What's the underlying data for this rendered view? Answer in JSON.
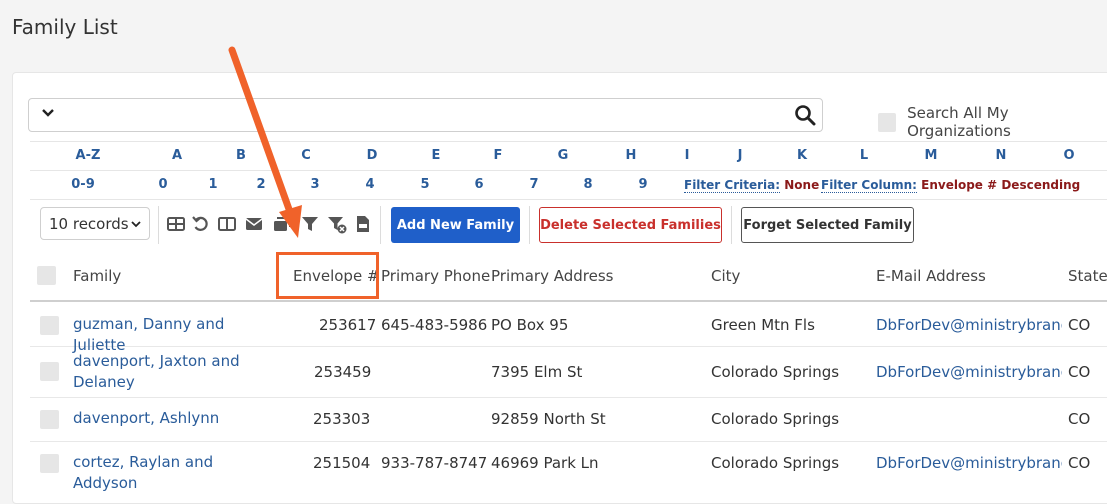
{
  "page": {
    "title": "Family List"
  },
  "search": {
    "option": "",
    "all_orgs_label": "Search All My Organizations"
  },
  "alpha": {
    "letters": [
      "A-Z",
      "A",
      "B",
      "C",
      "D",
      "E",
      "F",
      "G",
      "H",
      "I",
      "J",
      "K",
      "L",
      "M",
      "N",
      "O"
    ],
    "digits": [
      "0-9",
      "0",
      "1",
      "2",
      "3",
      "4",
      "5",
      "6",
      "7",
      "8",
      "9"
    ]
  },
  "filter": {
    "criteria_label": "Filter Criteria:",
    "criteria_value": "None",
    "column_label": "Filter Column:",
    "column_value": "Envelope # Descending"
  },
  "toolbar": {
    "records": "10 records",
    "add_label": "Add New Family",
    "delete_label": "Delete Selected Families",
    "forget_label": "Forget Selected Family",
    "icons": [
      "table-icon",
      "undo-icon",
      "columns-icon",
      "envelope-icon",
      "email-list-icon",
      "filter-icon",
      "clear-filter-icon",
      "csv-file-icon"
    ]
  },
  "table": {
    "headers": [
      "Family",
      "Envelope #",
      "Primary Phone",
      "Primary Address",
      "City",
      "E-Mail Address",
      "State,"
    ],
    "rows": [
      {
        "family": "guzman, Danny and Juliette",
        "envelope": "253617",
        "phone": "645-483-5986",
        "address": "PO Box 95",
        "city": "Green Mtn Fls",
        "email": "DbForDev@ministrybrands.",
        "state": "CO"
      },
      {
        "family": "davenport, Jaxton and Delaney",
        "envelope": "253459",
        "phone": "",
        "address": "7395 Elm St",
        "city": "Colorado Springs",
        "email": "DbForDev@ministrybrands.",
        "state": "CO"
      },
      {
        "family": "davenport, Ashlynn",
        "envelope": "253303",
        "phone": "",
        "address": "92859 North St",
        "city": "Colorado Springs",
        "email": "",
        "state": "CO"
      },
      {
        "family": "cortez, Raylan and Addyson",
        "envelope": "251504",
        "phone": "933-787-8747",
        "address": "46969 Park Ln",
        "city": "Colorado Springs",
        "email": "DbForDev@ministrybrands.",
        "state": "CO"
      }
    ]
  },
  "colors": {
    "accent": "#1f5fc9",
    "link": "#2a5c9a",
    "danger": "#c9302c",
    "annotation": "#f0622a"
  }
}
